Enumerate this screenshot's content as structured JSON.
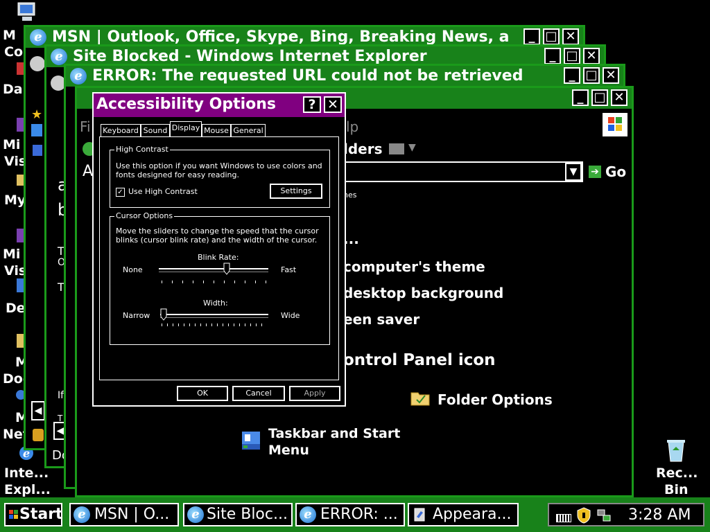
{
  "desktop_icons": [
    {
      "label": "M",
      "label2": "Co"
    },
    {
      "label": "Da"
    },
    {
      "label": "Mi",
      "label2": "Vis"
    },
    {
      "label": "My"
    },
    {
      "label": "Mi",
      "label2": "Vis"
    },
    {
      "label": "De"
    },
    {
      "label": "M",
      "label2": "Doc"
    },
    {
      "label": "M",
      "label2": "Net"
    },
    {
      "label": "Inte...",
      "label2": "Expl..."
    },
    {
      "label": "Rec...",
      "label2": "Bin"
    }
  ],
  "windows": {
    "msn": {
      "title": "MSN | Outlook, Office, Skype, Bing, Breaking News, a"
    },
    "blocked": {
      "title": "Site Blocked - Windows Internet Explorer",
      "side_letters": [
        "a",
        "b",
        "T",
        "O",
        "T",
        "If",
        "T"
      ],
      "status": "Do"
    },
    "error": {
      "title": "ERROR: The requested URL could not be retrieved -"
    },
    "appearance": {
      "menu_fragment": "Fi",
      "menu_fragment2": "lp",
      "toolbar_fragment": "lders",
      "address_fragment": "A",
      "go_label": "Go",
      "small_fragment": "nes",
      "dots": "...",
      "items": [
        "computer's theme",
        "desktop background",
        "een saver",
        "ontrol Panel icon",
        "Folder Options",
        "Taskbar and Start",
        "Menu"
      ]
    }
  },
  "dialog": {
    "title": "Accessibility Options",
    "help_btn": "?",
    "close_btn": "✕",
    "tabs": [
      "Keyboard",
      "Sound",
      "Display",
      "Mouse",
      "General"
    ],
    "active_tab": "Display",
    "high_contrast": {
      "group_label": "High Contrast",
      "description": "Use this option if you want Windows to use colors and fonts designed for easy reading.",
      "checkbox_label": "Use High Contrast",
      "checked": true,
      "settings_button": "Settings"
    },
    "cursor_options": {
      "group_label": "Cursor Options",
      "description": "Move the sliders to change the speed that the cursor blinks (cursor blink rate) and the width of the cursor.",
      "blink_rate": {
        "label": "Blink Rate:",
        "min_label": "None",
        "max_label": "Fast",
        "value_fraction": 0.63
      },
      "width": {
        "label": "Width:",
        "min_label": "Narrow",
        "max_label": "Wide",
        "value_fraction": 0.0
      }
    },
    "buttons": {
      "ok": "OK",
      "cancel": "Cancel",
      "apply": "Apply"
    }
  },
  "taskbar": {
    "start_label": "Start",
    "tasks": [
      {
        "label": "MSN | O..."
      },
      {
        "label": "Site Bloc..."
      },
      {
        "label": "ERROR: ..."
      },
      {
        "label": "Appeara..."
      }
    ],
    "clock": "3:28 AM"
  },
  "colors": {
    "window_border": "#1a9a1a",
    "titlebar": "#18821a",
    "dialog_title": "#800080",
    "background": "#000000"
  }
}
